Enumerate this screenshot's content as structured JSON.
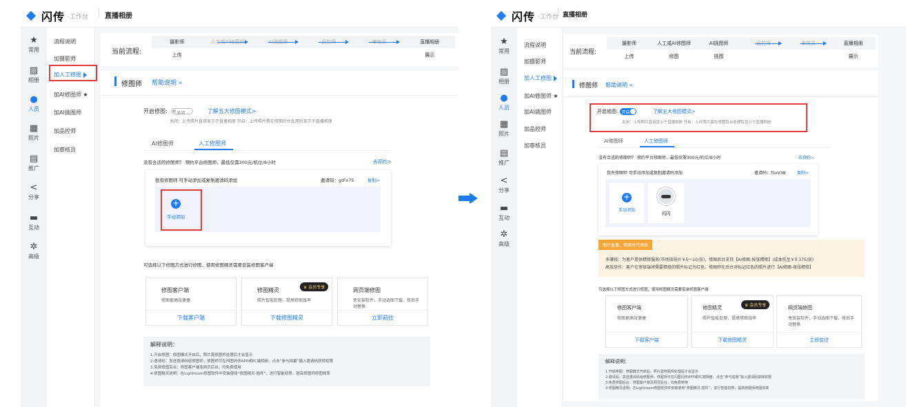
{
  "header": {
    "brand": "闪传",
    "sub": "·工作台",
    "nav_title": "直播相册"
  },
  "rail": {
    "items": [
      {
        "label": "常用",
        "icon": "star-icon"
      },
      {
        "label": "相册",
        "icon": "image-icon"
      },
      {
        "label": "人员",
        "icon": "user-icon"
      },
      {
        "label": "照片",
        "icon": "photo-icon"
      },
      {
        "label": "推广",
        "icon": "promote-icon"
      },
      {
        "label": "分享",
        "icon": "share-icon"
      },
      {
        "label": "互动",
        "icon": "chat-icon"
      },
      {
        "label": "高级",
        "icon": "gear-icon"
      }
    ]
  },
  "submenu": {
    "items": [
      "流程说明",
      "加摄影师",
      "加人工修图",
      "加AI修图师",
      "加AI挑图师",
      "加品控师",
      "加审核员"
    ]
  },
  "flow": {
    "label": "当前流程:",
    "headers": [
      "摄影师",
      "人工或AI修图师",
      "AI挑图师",
      "品控师",
      "审核员",
      "直播相册"
    ],
    "left_row": [
      "上传",
      "",
      "",
      "",
      "",
      "展示"
    ],
    "right_row": [
      "上传",
      "修图",
      "挑图",
      "",
      "",
      "展示"
    ]
  },
  "section": {
    "title": "修图师",
    "help": "帮助说明 »"
  },
  "retouch": {
    "label": "开启修图:",
    "toggle_off": "关闭",
    "toggle_on": "开启",
    "learn": "了解五大修图模式>",
    "hint": "关闭：上传照片直接显示于直播相册 开启：上传照片需在修图后台处理后显示于直播相册"
  },
  "tabs": [
    "AI修图师",
    "人工修图师"
  ],
  "no_retoucher": {
    "text": "没有合适的修图师？ 预约平台修图师，最低仅需300元/机位/8小时",
    "link": "去预约>"
  },
  "my_team": {
    "title": "我有修图师  可手动添加或复制邀请码添加",
    "code_label_left": "邀请码：gtFx75",
    "code_label_right": "邀请码：fSxV38",
    "copy": "复制>",
    "add": "手动添加",
    "member_name": "闪闪"
  },
  "promo": {
    "badge": "图片直播，精修时代来临",
    "line1": "多赚钱：为客户提供精修服务(市场指导价￥5～10/张)，修图后台支持【AI修图-按张精修】(成本低至￥0.375/张)",
    "line2": "高效协作：客户在审核端将需要精修的照片标记为红色，修图师在后台对标记红色的照片进行【AI修图-按张精修】"
  },
  "tools_intro": "可选择以下修图方式进行修图，使用修图精灵需要安装修图客户端",
  "tools": [
    {
      "name": "修图客户端",
      "desc": "修图更高效便捷",
      "action": "下载客户端"
    },
    {
      "name": "修图精灵",
      "desc": "照片智能处理，提高修图效率",
      "action": "下载修图精灵",
      "vip": "♛ 会员专享"
    },
    {
      "name": "网页端修图",
      "desc": "免安装软件，手动选图下载、修后手动替换",
      "action": "立即前往"
    }
  ],
  "explain": {
    "title": "解释说明：",
    "lines": [
      "1.开启修图：修图模式开启后，照片需修图师处理后才会显示",
      "2.邀请码：发送邀请码给修图师，修图师可在闪图闪传APP或PC端相册，点击“参与拍摄”输入邀请码获得权限",
      "3.免费修图后台：修图客户端及网页后台，均免费使用",
      "4.修图精灵说明：在Lightroom修图软件中安装使用“修图精灵-插件”，进行智能初修，提高修图师修图效率"
    ]
  }
}
